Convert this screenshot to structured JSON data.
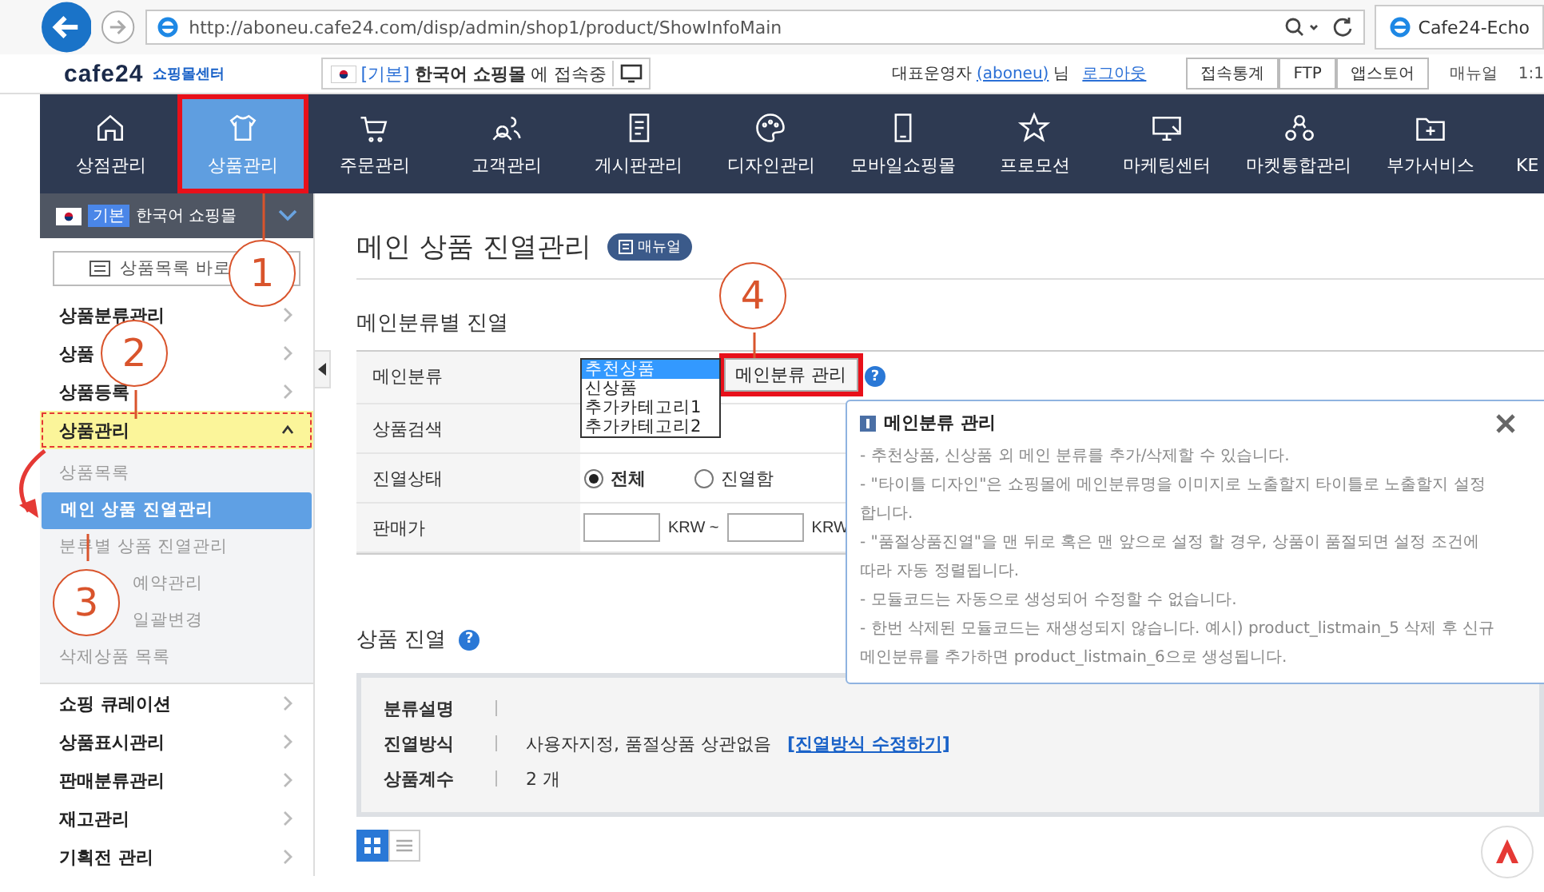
{
  "browser": {
    "url": "http://aboneu.cafe24.com/disp/admin/shop1/product/ShowInfoMain",
    "tab_title": "Cafe24-Echo"
  },
  "header": {
    "logo": "cafe24",
    "logo_sub": "쇼핑몰센터",
    "shop_prefix": "[기본]",
    "shop_name": "한국어 쇼핑몰",
    "shop_suffix": "에 접속중",
    "admin_label": "대표운영자",
    "admin_id": "(aboneu)",
    "admin_suffix": "님",
    "logout": "로그아웃",
    "buttons": [
      "접속통계",
      "FTP",
      "앱스토어"
    ],
    "manual": "매뉴얼",
    "extra": "1:1"
  },
  "nav": [
    {
      "label": "상점관리",
      "selected": false,
      "marked": false
    },
    {
      "label": "상품관리",
      "selected": true,
      "marked": true
    },
    {
      "label": "주문관리",
      "selected": false,
      "marked": false
    },
    {
      "label": "고객관리",
      "selected": false,
      "marked": false
    },
    {
      "label": "게시판관리",
      "selected": false,
      "marked": false
    },
    {
      "label": "디자인관리",
      "selected": false,
      "marked": false
    },
    {
      "label": "모바일쇼핑몰",
      "selected": false,
      "marked": false
    },
    {
      "label": "프로모션",
      "selected": false,
      "marked": false
    },
    {
      "label": "마케팅센터",
      "selected": false,
      "marked": false
    },
    {
      "label": "마켓통합관리",
      "selected": false,
      "marked": false
    },
    {
      "label": "부가서비스",
      "selected": false,
      "marked": false
    },
    {
      "label": "KE",
      "selected": false,
      "marked": false
    }
  ],
  "sidebar": {
    "shop_badge": "기본",
    "shop_name": "한국어 쇼핑몰",
    "shortcut": "상품목록 바로",
    "menu": [
      {
        "label": "상품분류관리",
        "expanded": false,
        "marked": false
      },
      {
        "label": "상품",
        "expanded": false,
        "marked": false
      },
      {
        "label": "상품등록",
        "expanded": false,
        "marked": false
      },
      {
        "label": "상품관리",
        "expanded": true,
        "marked": true,
        "children": [
          {
            "label": "상품목록",
            "selected": false
          },
          {
            "label": "메인 상품 진열관리",
            "selected": true
          },
          {
            "label": "분류별 상품 진열관리",
            "selected": false
          },
          {
            "label": "예약관리",
            "selected": false,
            "kind": "partial"
          },
          {
            "label": "일괄변경",
            "selected": false,
            "kind": "partial"
          },
          {
            "label": "삭제상품 목록",
            "selected": false
          }
        ]
      },
      {
        "label": "쇼핑 큐레이션",
        "expanded": false,
        "marked": false
      },
      {
        "label": "상품표시관리",
        "expanded": false,
        "marked": false
      },
      {
        "label": "판매분류관리",
        "expanded": false,
        "marked": false
      },
      {
        "label": "재고관리",
        "expanded": false,
        "marked": false
      },
      {
        "label": "기획전 관리",
        "expanded": false,
        "marked": false
      }
    ]
  },
  "main": {
    "title": "메인 상품 진열관리",
    "manual_badge": "매뉴얼",
    "section": "메인분류별 진열",
    "form": {
      "category_label": "메인분류",
      "categories": [
        {
          "label": "추천상품",
          "selected": true
        },
        {
          "label": "신상품",
          "selected": false
        },
        {
          "label": "추가카테고리1",
          "selected": false
        },
        {
          "label": "추가카테고리2",
          "selected": false
        }
      ],
      "manage_button": {
        "label": "메인분류 관리",
        "marked": true
      },
      "help": "?",
      "search_label": "상품검색",
      "status_label": "진열상태",
      "status_options": [
        {
          "label": "전체",
          "checked": true
        },
        {
          "label": "진열함",
          "checked": false
        }
      ],
      "price_label": "판매가",
      "currency_from": "KRW ~",
      "currency_to": "KRW"
    },
    "popup": {
      "title": "메인분류 관리",
      "lines": [
        "- 추천상품, 신상품 외 메인 분류를 추가/삭제할 수 있습니다.",
        "- \"타이틀 디자인\"은 쇼핑몰에 메인분류명을 이미지로 노출할지 타이틀로 노출할지 설정합니다.",
        "- \"품절상품진열\"을 맨 뒤로 혹은 맨 앞으로 설정 할 경우, 상품이 품절되면 설정 조건에 따라 자동 정렬됩니다.",
        "- 모듈코드는 자동으로 생성되어 수정할 수 없습니다.",
        "- 한번 삭제된 모듈코드는 재생성되지 않습니다. 예시) product_listmain_5 삭제 후 신규 메인분류를 추가하면 product_listmain_6으로 생성됩니다."
      ]
    },
    "display": {
      "title": "상품 진열",
      "help": "?",
      "rows": [
        {
          "label": "분류설명"
        },
        {
          "label": "진열방식",
          "value": "사용자지정, 품절상품 상관없음",
          "link": "[진열방식 수정하기]"
        },
        {
          "label": "상품계수",
          "value": "2 개"
        }
      ],
      "views": [
        {
          "kind": "grid",
          "selected": true
        },
        {
          "kind": "list",
          "selected": false
        }
      ]
    }
  },
  "callouts": [
    "1",
    "2",
    "3",
    "4"
  ]
}
